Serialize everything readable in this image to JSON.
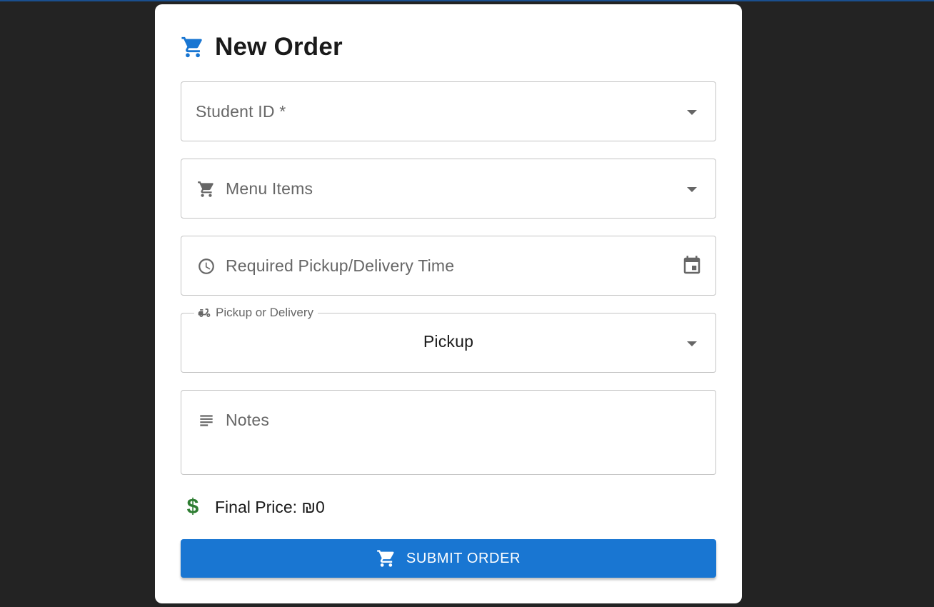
{
  "form": {
    "title": "New Order",
    "title_icon": "cart-icon",
    "student_id": {
      "placeholder": "Student ID *",
      "icon": "chevron-down-icon"
    },
    "menu_items": {
      "placeholder": "Menu Items",
      "icon": "cart-icon"
    },
    "pickup_time": {
      "placeholder": "Required Pickup/Delivery Time",
      "icon": "clock-icon",
      "trailing_icon": "calendar-icon"
    },
    "pickup_or_delivery": {
      "label": "Pickup or Delivery",
      "icon": "scooter-icon",
      "value": "Pickup"
    },
    "notes": {
      "placeholder": "Notes",
      "icon": "notes-icon"
    },
    "final_price": {
      "label": "Final Price: ₪0",
      "icon": "dollar-icon"
    },
    "submit": {
      "label": "SUBMIT ORDER",
      "icon": "cart-icon"
    }
  },
  "colors": {
    "accent": "#1976d2",
    "price_icon": "#2e7d32",
    "background": "#232323"
  }
}
